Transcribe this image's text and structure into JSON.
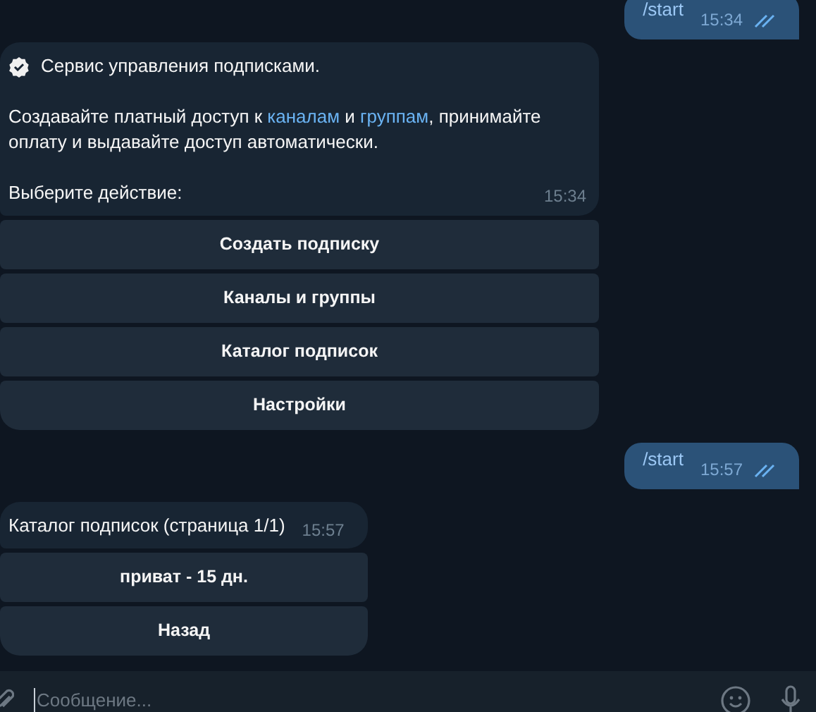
{
  "messages": [
    {
      "kind": "outgoing",
      "text": "/start",
      "time": "15:34",
      "read": true
    },
    {
      "kind": "incoming",
      "verified": true,
      "paragraphs": [
        {
          "segments": [
            {
              "kind": "text",
              "text": "Сервис управления подписками."
            }
          ]
        },
        {
          "segments": [
            {
              "kind": "text",
              "text": "Создавайте платный доступ к "
            },
            {
              "kind": "link",
              "text": "каналам"
            },
            {
              "kind": "text",
              "text": " и "
            },
            {
              "kind": "link",
              "text": "группам"
            },
            {
              "kind": "text",
              "text": ", принимайте оплату и выдавайте доступ автоматически."
            }
          ]
        },
        {
          "segments": [
            {
              "kind": "text",
              "text": "Выберите действие:"
            }
          ]
        }
      ],
      "time": "15:34",
      "buttons": [
        "Создать подписку",
        "Каналы и группы",
        "Каталог подписок",
        "Настройки"
      ]
    },
    {
      "kind": "outgoing",
      "text": "/start",
      "time": "15:57",
      "read": true
    },
    {
      "kind": "incoming",
      "paragraphs": [
        {
          "segments": [
            {
              "kind": "text",
              "text": "Каталог подписок (страница 1/1)"
            }
          ]
        }
      ],
      "time": "15:57",
      "buttons": [
        "приват - 15 дн.",
        "Назад"
      ]
    }
  ],
  "composer": {
    "placeholder": "Сообщение..."
  }
}
